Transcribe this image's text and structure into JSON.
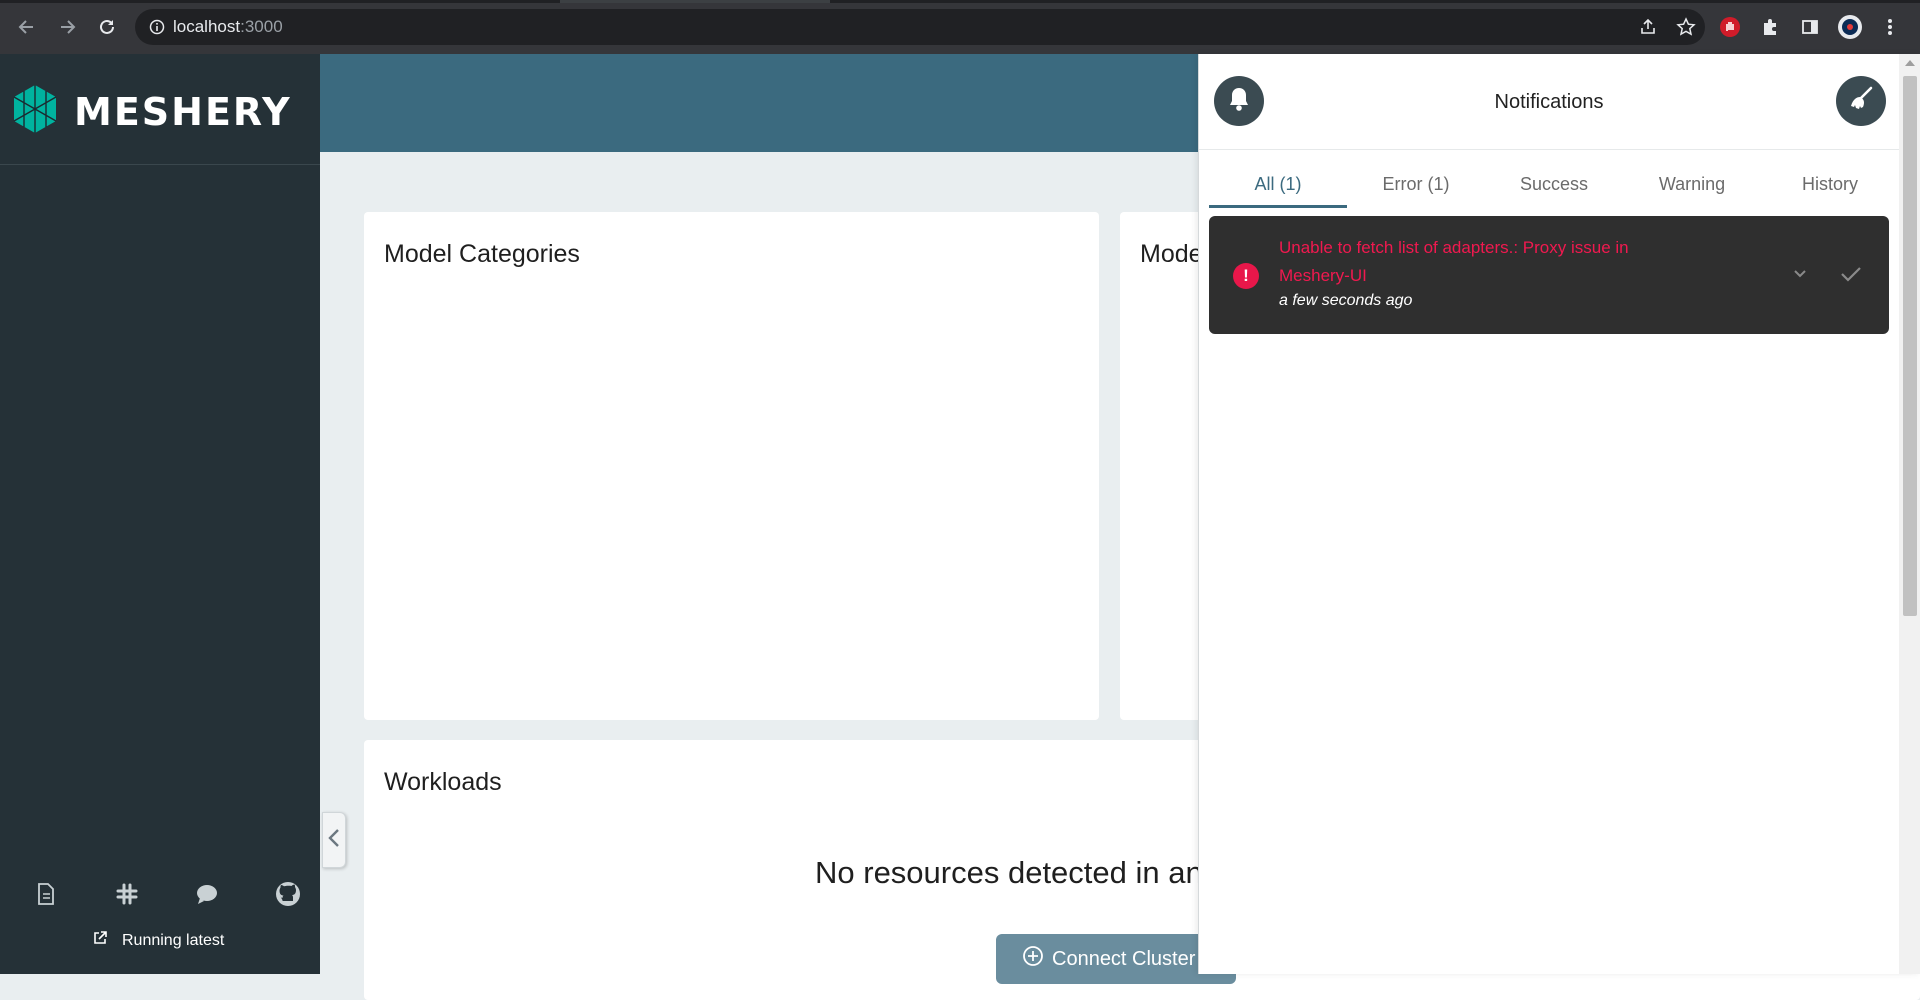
{
  "browser": {
    "url_host": "localhost",
    "url_port": ":3000"
  },
  "sidebar": {
    "logo_text": "MESHERY",
    "footer_icons": [
      "docs-icon",
      "slack-icon",
      "chat-icon",
      "github-icon"
    ],
    "running_label": "Running latest"
  },
  "main": {
    "cards": {
      "model_categories_title": "Model Categories",
      "models_title": "Mode",
      "workloads_title": "Workloads"
    },
    "no_resources_text": "No resources detected in an",
    "connect_button_label": "Connect Cluster"
  },
  "notifications": {
    "title": "Notifications",
    "tabs": [
      {
        "label": "All (1)",
        "active": true
      },
      {
        "label": "Error (1)",
        "active": false
      },
      {
        "label": "Success",
        "active": false
      },
      {
        "label": "Warning",
        "active": false
      },
      {
        "label": "History",
        "active": false
      }
    ],
    "items": [
      {
        "severity": "error",
        "message": "Unable to fetch list of adapters.: Proxy issue in Meshery-UI",
        "time": "a few seconds ago"
      }
    ]
  },
  "colors": {
    "topbar": "#3b6a7f",
    "sidebar": "#253137",
    "accent_teal": "#00b39f",
    "error": "#f0194f"
  }
}
